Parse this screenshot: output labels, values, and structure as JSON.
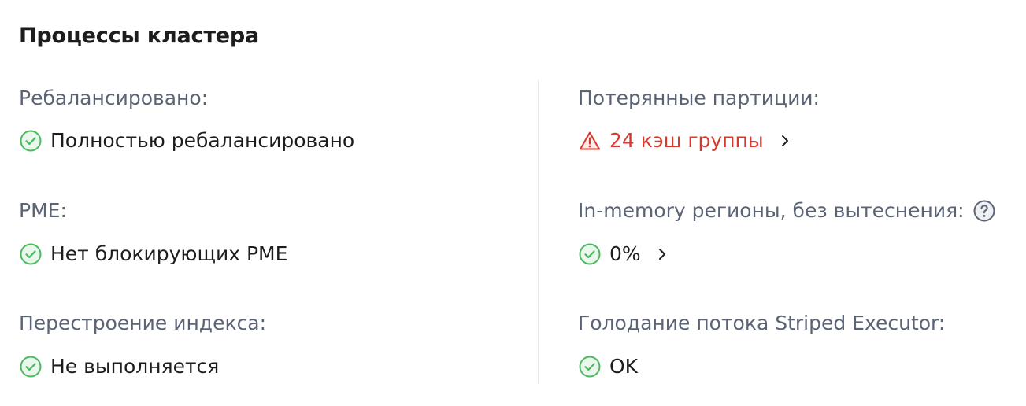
{
  "section": {
    "title": "Процессы кластера"
  },
  "left": {
    "rebalance": {
      "label": "Ребалансировано:",
      "value": "Полностью ребалансировано",
      "icon": "check-circle-icon"
    },
    "pme": {
      "label": "PME:",
      "value": "Нет блокирующих PME",
      "icon": "check-circle-icon"
    },
    "index_rebuild": {
      "label": "Перестроение индекса:",
      "value": "Не выполняется",
      "icon": "check-circle-icon"
    }
  },
  "right": {
    "lost_partitions": {
      "label": "Потерянные партиции:",
      "value": "24 кэш группы",
      "icon": "warning-triangle-icon"
    },
    "inmemory_regions": {
      "label": "In-memory регионы, без вытеснения:",
      "value": "0%",
      "icon": "check-circle-icon",
      "help_icon": "question-circle-icon"
    },
    "striped_executor": {
      "label": "Голодание потока Striped Executor:",
      "value": "OK",
      "icon": "check-circle-icon"
    }
  },
  "colors": {
    "success": "#4cb860",
    "danger": "#d63a2f",
    "label": "#5b6475",
    "text": "#1d1d1f",
    "divider": "#e4e6ea"
  }
}
